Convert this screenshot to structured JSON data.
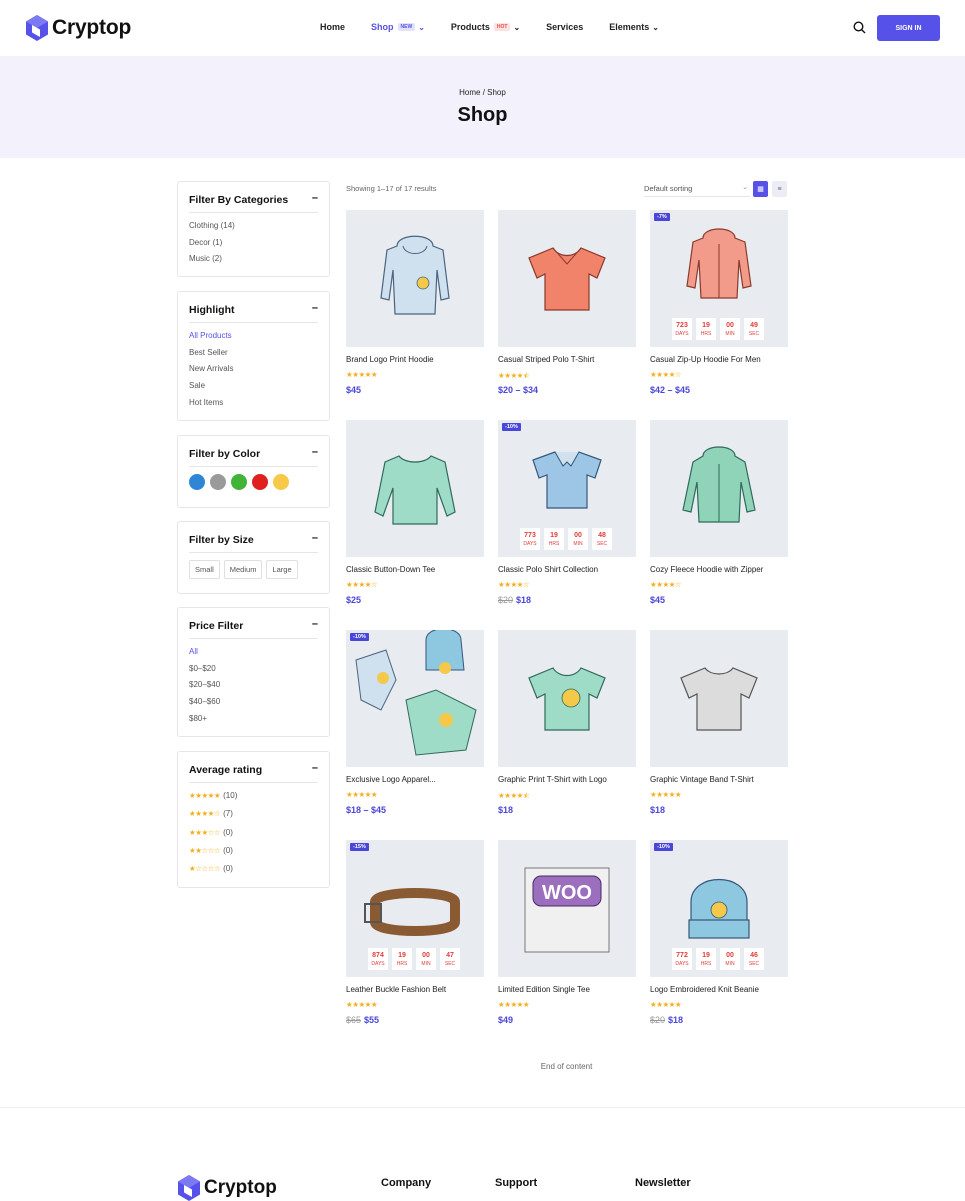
{
  "header": {
    "logo": "Cryptop",
    "nav": [
      {
        "label": "Home",
        "badge": ""
      },
      {
        "label": "Shop",
        "badge": "NEW"
      },
      {
        "label": "Products",
        "badge": "HOT"
      },
      {
        "label": "Services",
        "badge": ""
      },
      {
        "label": "Elements",
        "badge": ""
      }
    ],
    "signin": "SIGN IN"
  },
  "banner": {
    "breadcrumb": "Home / Shop",
    "title": "Shop"
  },
  "sidebar": {
    "categories": {
      "title": "Filter By Categories",
      "items": [
        "Clothing (14)",
        "Decor (1)",
        "Music (2)"
      ]
    },
    "highlight": {
      "title": "Highlight",
      "items": [
        "All Products",
        "Best Seller",
        "New Arrivals",
        "Sale",
        "Hot Items"
      ],
      "selected": "All Products"
    },
    "color": {
      "title": "Filter by Color",
      "colors": [
        "#2f86d6",
        "#9a9a9a",
        "#41b336",
        "#e01f1f",
        "#f7c948"
      ]
    },
    "size": {
      "title": "Filter by Size",
      "items": [
        "Small",
        "Medium",
        "Large"
      ]
    },
    "price": {
      "title": "Price Filter",
      "items": [
        "All",
        "$0–$20",
        "$20–$40",
        "$40–$60",
        "$80+"
      ],
      "selected": "All"
    },
    "rating": {
      "title": "Average rating",
      "items": [
        {
          "stars": 5,
          "count": "(10)"
        },
        {
          "stars": 4,
          "count": "(7)"
        },
        {
          "stars": 3,
          "count": "(0)"
        },
        {
          "stars": 2,
          "count": "(0)"
        },
        {
          "stars": 1,
          "count": "(0)"
        }
      ]
    }
  },
  "toolbar": {
    "showing": "Showing 1–17 of 17 results",
    "sorting": "Default sorting"
  },
  "products": [
    {
      "name": "Brand Logo Print Hoodie",
      "rating": 5,
      "old_price": "",
      "price": "$45",
      "discount": "",
      "countdown": null
    },
    {
      "name": "Casual Striped Polo T-Shirt",
      "rating": 4.5,
      "old_price": "",
      "price": "$20 – $34",
      "discount": "",
      "countdown": null
    },
    {
      "name": "Casual Zip-Up Hoodie For Men",
      "rating": 4,
      "old_price": "",
      "price": "$42 – $45",
      "discount": "-7%",
      "countdown": {
        "days": "723",
        "hrs": "19",
        "min": "00",
        "sec": "49"
      }
    },
    {
      "name": "Classic Button-Down Tee",
      "rating": 4,
      "old_price": "",
      "price": "$25",
      "discount": "",
      "countdown": null
    },
    {
      "name": "Classic Polo Shirt Collection",
      "rating": 4,
      "old_price": "$20",
      "price": "$18",
      "discount": "-10%",
      "countdown": {
        "days": "773",
        "hrs": "19",
        "min": "00",
        "sec": "48"
      }
    },
    {
      "name": "Cozy Fleece Hoodie with Zipper",
      "rating": 4,
      "old_price": "",
      "price": "$45",
      "discount": "",
      "countdown": null
    },
    {
      "name": "Exclusive Logo Apparel...",
      "rating": 5,
      "old_price": "",
      "price": "$18 – $45",
      "discount": "-10%",
      "countdown": null
    },
    {
      "name": "Graphic Print T-Shirt with Logo",
      "rating": 4.5,
      "old_price": "",
      "price": "$18",
      "discount": "",
      "countdown": null
    },
    {
      "name": "Graphic Vintage Band T-Shirt",
      "rating": 5,
      "old_price": "",
      "price": "$18",
      "discount": "",
      "countdown": null
    },
    {
      "name": "Leather Buckle Fashion Belt",
      "rating": 5,
      "old_price": "$65",
      "price": "$55",
      "discount": "-15%",
      "countdown": {
        "days": "874",
        "hrs": "19",
        "min": "00",
        "sec": "47"
      }
    },
    {
      "name": "Limited Edition Single Tee",
      "rating": 5,
      "old_price": "",
      "price": "$49",
      "discount": "",
      "countdown": null
    },
    {
      "name": "Logo Embroidered Knit Beanie",
      "rating": 5,
      "old_price": "$20",
      "price": "$18",
      "discount": "-10%",
      "countdown": {
        "days": "772",
        "hrs": "19",
        "min": "00",
        "sec": "46"
      }
    }
  ],
  "countdown_labels": {
    "days": "DAYS",
    "hrs": "HRS",
    "min": "MIN",
    "sec": "SEC"
  },
  "end_of_content": "End of content",
  "footer": {
    "logo": "Cryptop",
    "headings": [
      "Company",
      "Support",
      "Newsletter"
    ]
  },
  "colors": {
    "accent": "#5651e8",
    "star": "#f2b01e",
    "countdown": "#e23b3b"
  }
}
